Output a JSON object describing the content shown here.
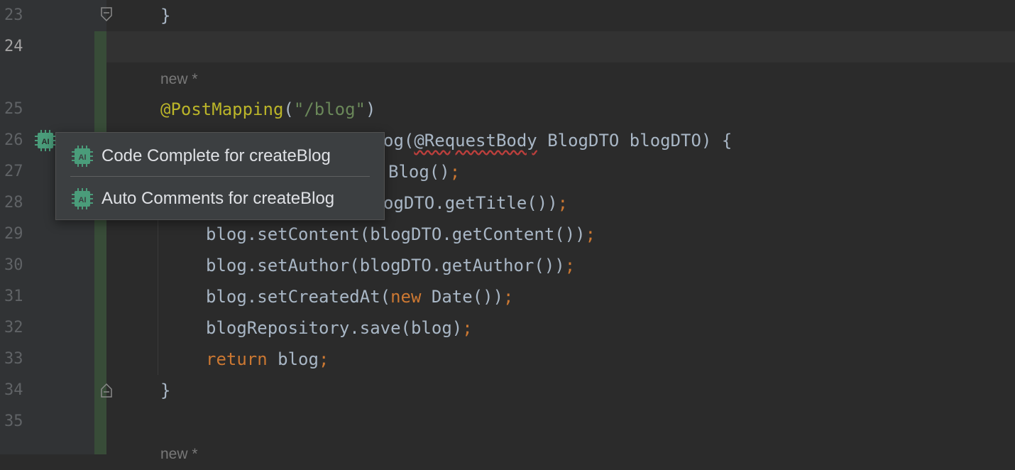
{
  "editor": {
    "line_numbers": [
      "23",
      "24",
      "25",
      "26",
      "27",
      "28",
      "29",
      "30",
      "31",
      "32",
      "33",
      "34",
      "35"
    ],
    "active_line": "24",
    "hints": {
      "new_badge_1": "new *",
      "new_badge_2": "new *"
    },
    "code": {
      "l23_brace": "}",
      "l25_ann": "@PostMapping",
      "l25_open": "(",
      "l25_str": "\"/blog\"",
      "l25_close": ")",
      "l26_part1": "og(",
      "l26_ann": "@RequestBody",
      "l26_part2": " BlogDTO blogDTO) {",
      "l27_part": "Blog()",
      "l27_semi": ";",
      "l28_part": "ogDTO.getTitle())",
      "l28_semi": ";",
      "l29_part": "blog.setContent(blogDTO.getContent())",
      "l29_semi": ";",
      "l30_part": "blog.setAuthor(blogDTO.getAuthor())",
      "l30_semi": ";",
      "l31_part1": "blog.setCreatedAt(",
      "l31_kw": "new",
      "l31_part2": " Date())",
      "l31_semi": ";",
      "l32_part": "blogRepository.save(blog)",
      "l32_semi": ";",
      "l33_kw": "return",
      "l33_part": " blog",
      "l33_semi": ";",
      "l34_brace": "}"
    }
  },
  "gutter_icon": {
    "text": "AI",
    "color": "#4a9c7a"
  },
  "popup": {
    "items": [
      {
        "icon": "ai-chip-icon",
        "label": "Code Complete for createBlog"
      },
      {
        "icon": "ai-chip-icon",
        "label": "Auto Comments for createBlog"
      }
    ]
  },
  "colors": {
    "background": "#2b2b2b",
    "annotation": "#bbb529",
    "string": "#6a8759",
    "keyword": "#cc7832",
    "identifier": "#a9b7c6",
    "ai_icon": "#4a9c7a"
  }
}
